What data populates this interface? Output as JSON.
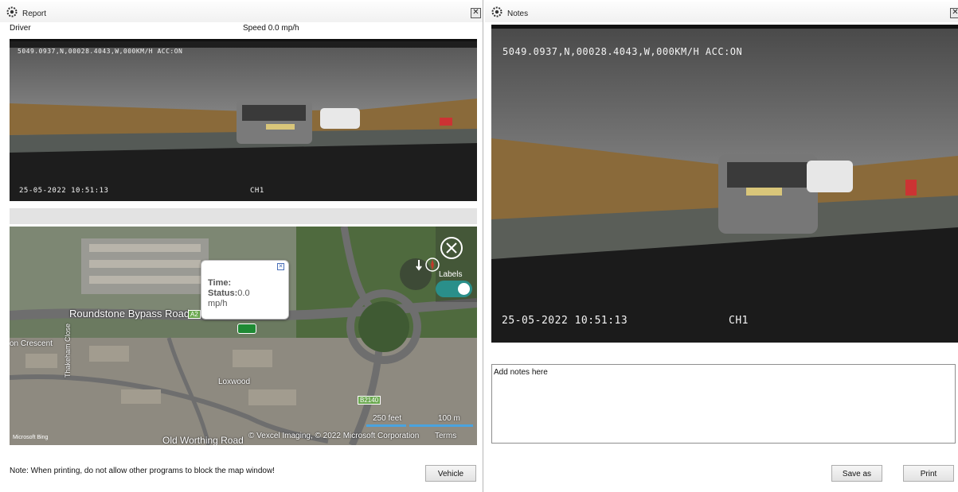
{
  "report": {
    "title": "Report",
    "driver_label": "Driver",
    "speed_text": "Speed 0.0 mp/h",
    "camera": {
      "top_overlay": "5049.0937,N,00028.4043,W,000KM/H ACC:ON",
      "timestamp": "25-05-2022 10:51:13",
      "channel": "CH1"
    },
    "map": {
      "popup_time_label": "Time:",
      "popup_status_label": "Status:",
      "popup_status_value": "0.0",
      "popup_unit": "mp/h",
      "road_roundstone": "Roundstone Bypass Road",
      "road_a2": "A2",
      "road_crescent": "on Crescent",
      "road_thakeham": "Thakeham Close",
      "road_loxwood": "Loxwood",
      "road_b2140": "B2140",
      "road_worthing": "Old Worthing Road",
      "labels_toggle": "Labels",
      "scale_feet": "250 feet",
      "scale_m": "100 m",
      "copyright": "© Vexcel Imaging, © 2022 Microsoft Corporation",
      "terms": "Terms",
      "bing": "Microsoft Bing"
    },
    "footer_note": "Note: When printing, do not allow other programs to block the map window!",
    "vehicle_button": "Vehicle"
  },
  "notes": {
    "title": "Notes",
    "camera": {
      "top_overlay": "5049.0937,N,00028.4043,W,000KM/H ACC:ON",
      "timestamp": "25-05-2022 10:51:13",
      "channel": "CH1"
    },
    "placeholder": "Add notes here",
    "save_button": "Save as",
    "print_button": "Print"
  },
  "icons": {
    "window": "gear-icon",
    "close": "close-icon",
    "map_close": "circle-close-icon",
    "compass": "compass-icon",
    "vehicle_marker": "vehicle-marker-icon"
  },
  "colors": {
    "toggle_accent": "#2a8f8a",
    "map_badge": "#6aa84f",
    "scale_bar": "#4aa3df"
  }
}
